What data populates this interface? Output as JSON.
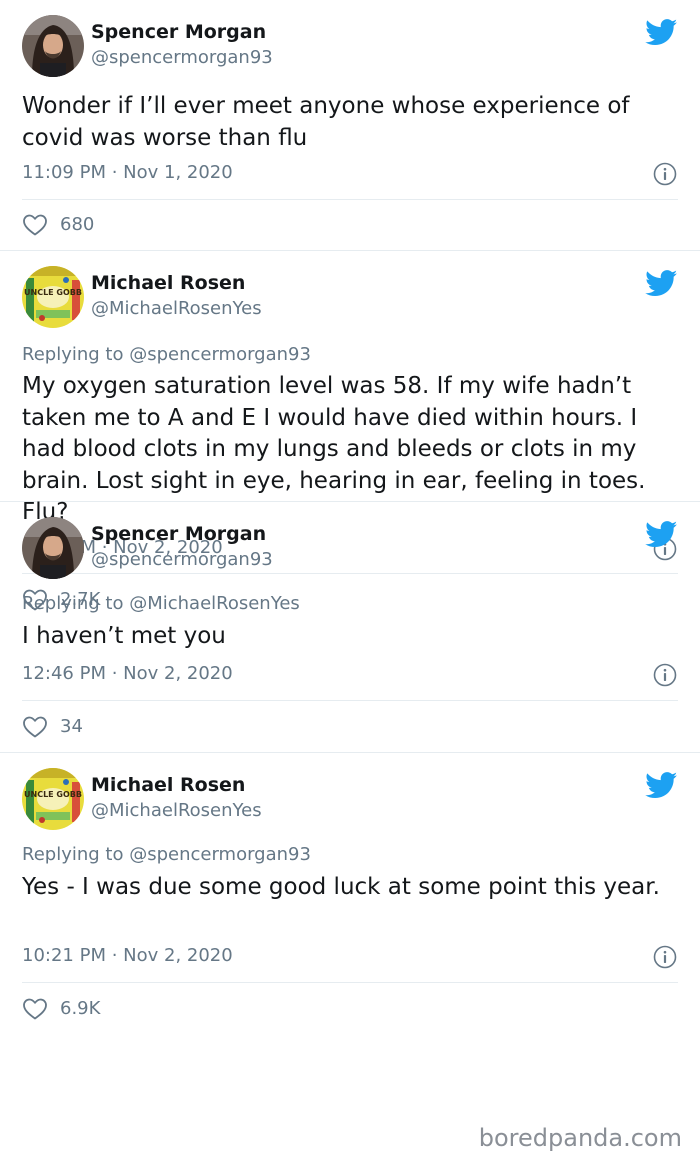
{
  "tweets": [
    {
      "author_name": "Spencer Morgan",
      "author_handle": "@spencermorgan93",
      "avatar_icon": "profile-photo-man-long-hair",
      "replying_to": "",
      "text": "Wonder if I’ll ever meet anyone whose experience of covid was worse than flu",
      "timestamp": "11:09 PM · Nov 1, 2020",
      "likes": "680"
    },
    {
      "author_name": "Michael Rosen",
      "author_handle": "@MichaelRosenYes",
      "avatar_icon": "book-cover-uncle-gobb",
      "avatar_text": "UNCLE GOBB",
      "replying_to": "Replying to @spencermorgan93",
      "text": "My oxygen saturation level was 58. If my wife hadn’t taken me to A and E I would have died within hours. I had blood clots in my lungs and bleeds or clots in my brain. Lost sight in eye, hearing in ear, feeling in toes. Flu?",
      "timestamp": "8:53 AM · Nov 2, 2020",
      "likes": "2.7K"
    },
    {
      "author_name": "Spencer Morgan",
      "author_handle": "@spencermorgan93",
      "avatar_icon": "profile-photo-man-long-hair",
      "replying_to": "Replying to @MichaelRosenYes",
      "text": "I haven’t met you",
      "timestamp": "12:46 PM · Nov 2, 2020",
      "likes": "34"
    },
    {
      "author_name": "Michael Rosen",
      "author_handle": "@MichaelRosenYes",
      "avatar_icon": "book-cover-uncle-gobb",
      "avatar_text": "UNCLE GOBB",
      "replying_to": "Replying to @spencermorgan93",
      "text": "Yes -  I was due some good luck at some point this year.",
      "timestamp": "10:21 PM · Nov 2, 2020",
      "likes": "6.9K"
    }
  ],
  "watermark": "boredpanda.com",
  "colors": {
    "twitter_blue": "#1da1f2",
    "secondary_text": "#657786",
    "primary_text": "#14171a",
    "divider": "#e6ecf0"
  }
}
